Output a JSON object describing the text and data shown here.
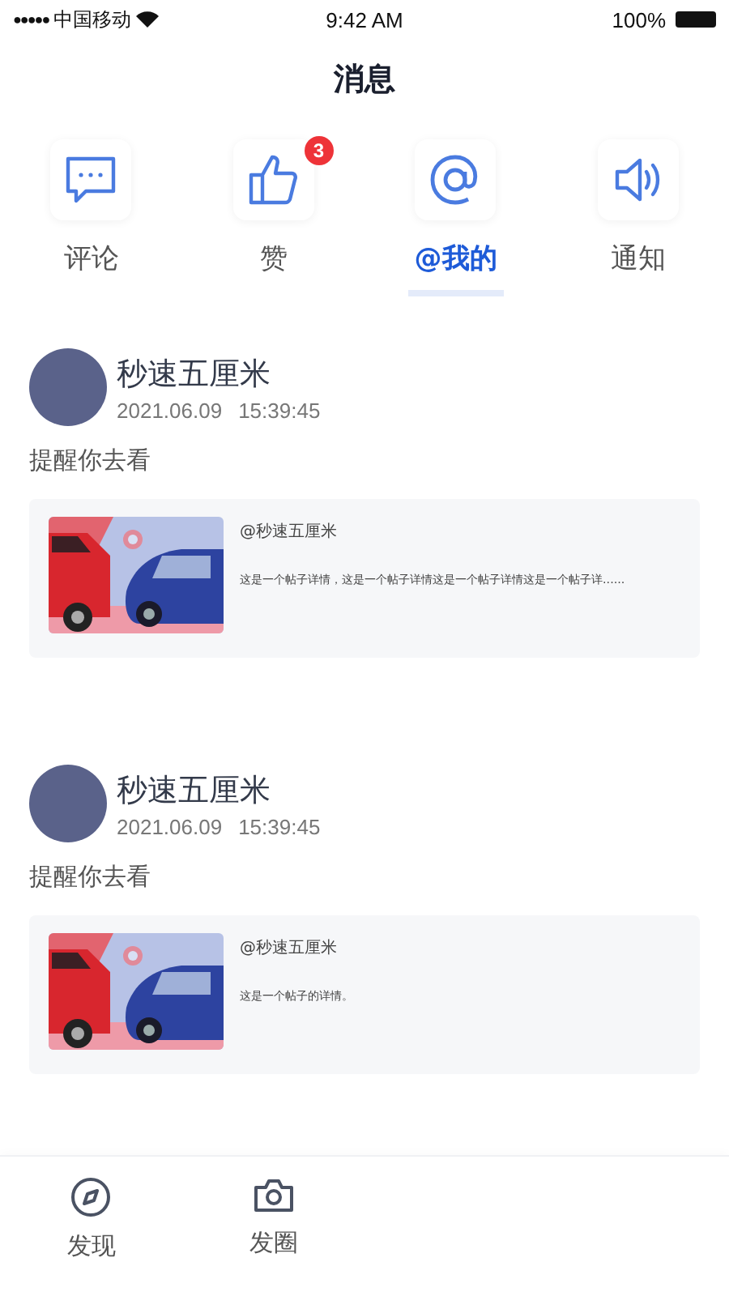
{
  "status_bar": {
    "signal": "●●●●●",
    "carrier": "中国移动",
    "time": "9:42 AM",
    "battery": "100%"
  },
  "title": "消息",
  "categories": [
    {
      "label": "评论",
      "selected": false
    },
    {
      "label": "赞",
      "selected": false,
      "badge": "3"
    },
    {
      "label": "@我的",
      "selected": true
    },
    {
      "label": "通知",
      "selected": false
    }
  ],
  "posts": [
    {
      "author": "秒速五厘米",
      "date": "2021.06.09",
      "time": "15:39:45",
      "message": "提醒你去看",
      "card": {
        "mention": "@秒速五厘米",
        "text": "这是一个帖子详情，这是一个帖子详情这是一个帖子详情这是一个帖子详......"
      }
    },
    {
      "author": "秒速五厘米",
      "date": "2021.06.09",
      "time": "15:39:45",
      "message": "提醒你去看",
      "card": {
        "mention": "@秒速五厘米",
        "text": "这是一个帖子的详情。"
      }
    }
  ],
  "tab_bar": [
    {
      "label": "发现"
    },
    {
      "label": "发圈"
    }
  ]
}
